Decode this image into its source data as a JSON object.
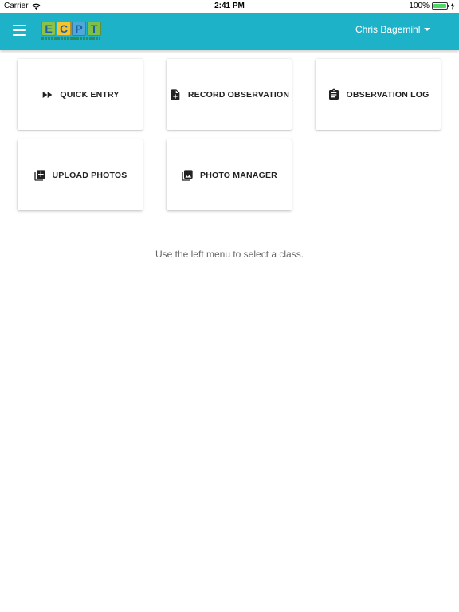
{
  "status_bar": {
    "carrier": "Carrier",
    "time": "2:41 PM",
    "battery": "100%",
    "battery_level": 1.0,
    "wifi_icon": "wifi-icon",
    "charging_icon": "bolt-icon"
  },
  "header": {
    "menu_icon": "hamburger-menu-icon",
    "logo_letters": [
      "E",
      "C",
      "P",
      "T"
    ],
    "logo_colors": [
      "#8bc34a",
      "#f4c430",
      "#4fa8d8",
      "#7cbf4a"
    ],
    "user_name": "Chris Bagemihl",
    "background": "#1eb2c9"
  },
  "cards": [
    {
      "label": "QUICK ENTRY",
      "icon": "fast-forward-icon"
    },
    {
      "label": "RECORD OBSERVATION",
      "icon": "note-add-icon"
    },
    {
      "label": "OBSERVATION LOG",
      "icon": "clipboard-icon"
    },
    {
      "label": "UPLOAD PHOTOS",
      "icon": "library-add-icon"
    },
    {
      "label": "PHOTO MANAGER",
      "icon": "photo-library-icon"
    }
  ],
  "main": {
    "hint": "Use the left menu to select a class."
  }
}
